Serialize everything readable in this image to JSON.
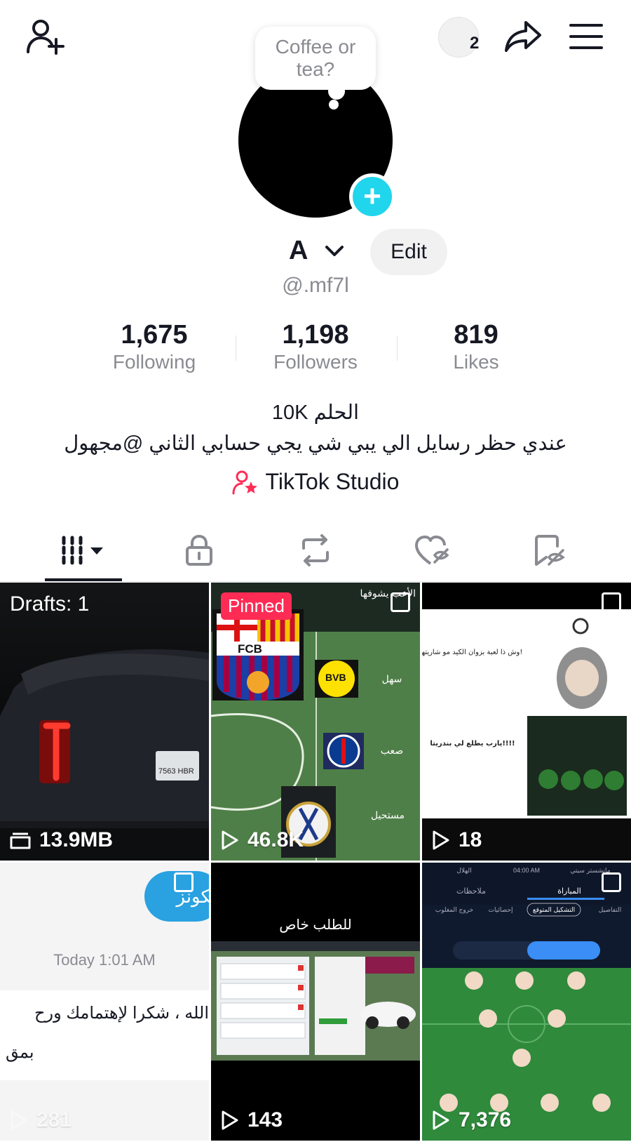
{
  "header": {
    "add_friend_icon": "person-add-icon",
    "notification_count": "2",
    "share_icon": "share-arrow-icon",
    "menu_icon": "hamburger-icon"
  },
  "profile": {
    "note_bubble": "Coffee or tea?",
    "name": "A",
    "edit_label": "Edit",
    "handle": "@.mf7l"
  },
  "stats": [
    {
      "value": "1,675",
      "label": "Following"
    },
    {
      "value": "1,198",
      "label": "Followers"
    },
    {
      "value": "819",
      "label": "Likes"
    }
  ],
  "bio": {
    "line1": "الحلم 10K",
    "line2": "عندي حظر رسايل الي يبي شي يجي حسابي الثاني @مجهول",
    "studio_label": "TikTok Studio"
  },
  "tabs": [
    {
      "icon": "videos-grid-icon"
    },
    {
      "icon": "lock-icon"
    },
    {
      "icon": "repost-icon"
    },
    {
      "icon": "liked-hidden-icon"
    },
    {
      "icon": "favorites-hidden-icon"
    }
  ],
  "videos": [
    {
      "overlay": "Drafts: 1",
      "stat": "13.9MB",
      "stat_icon": "folder-icon"
    },
    {
      "overlay": "Pinned",
      "stat": "46.8K",
      "stat_icon": "play-icon"
    },
    {
      "overlay": "",
      "stat": "18",
      "stat_icon": "play-icon"
    },
    {
      "overlay": "Today 1:01 AM",
      "stat": "281",
      "stat_icon": "play-icon"
    },
    {
      "overlay": "للطلب خاص",
      "stat": "143",
      "stat_icon": "play-icon"
    },
    {
      "overlay": "",
      "stat": "7,376",
      "stat_icon": "play-icon"
    }
  ],
  "thumb_text": {
    "v1_plate": "7563 HBR",
    "v2_top": "الأعب يشوفها",
    "v2_easy": "سهل",
    "v2_hard": "صعب",
    "v2_impossible": "مستحيل",
    "v2_fcb": "FCB",
    "v2_bvb": "BVB",
    "v3_q1": "وش ذا لعبة بزوان الكيد مو شاريتها!",
    "v3_q2": "يارب يطلع لي بندريتا!!!!",
    "v4_bubble": "الكونز",
    "v4_msg1": "الله ، شكرا لإهتمامك ورح",
    "v4_msg2": "بمق",
    "v6_team1": "الهلال",
    "v6_team2": "مانشستر سيتي",
    "v6_time": "04:00 AM",
    "v6_tab1": "المباراة",
    "v6_tab2": "ملاحظات",
    "v6_sub1": "التفاصيل",
    "v6_sub2": "التشكيل المتوقع",
    "v6_sub3": "إحصائيات",
    "v6_sub4": "خروج المغلوب"
  },
  "colors": {
    "accent_pink": "#fe2c55",
    "avatar_plus": "#20d5ec",
    "muted_text": "#8a8b91"
  }
}
